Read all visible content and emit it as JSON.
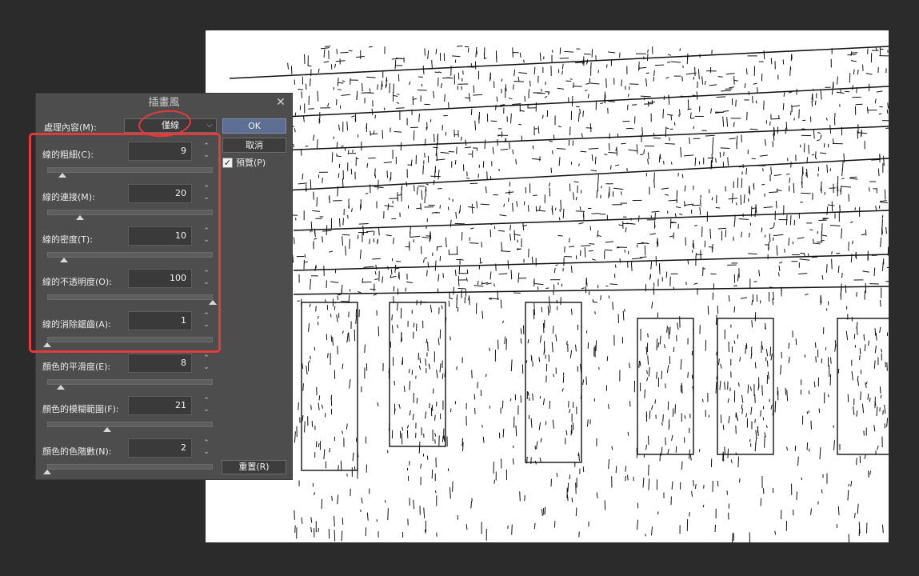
{
  "dialog": {
    "title": "插畫風",
    "close_icon": "close-icon",
    "process_label": "處理內容(M):",
    "process_value": "僅線",
    "ok_label": "OK",
    "cancel_label": "取消",
    "preview_label": "預覽(P)",
    "preview_checked": true,
    "reset_label": "重置(R)"
  },
  "params": [
    {
      "label": "線的粗細(C):",
      "value": "9",
      "level": 0.09
    },
    {
      "label": "線的連接(M):",
      "value": "20",
      "level": 0.2
    },
    {
      "label": "線的密度(T):",
      "value": "10",
      "level": 0.1
    },
    {
      "label": "線的不透明度(O):",
      "value": "100",
      "level": 1.0
    },
    {
      "label": "線的消除鋸齒(A):",
      "value": "1",
      "level": 0.0
    },
    {
      "label": "顏色的平滑度(E):",
      "value": "8",
      "level": 0.08
    },
    {
      "label": "顏色的模糊範圍(F):",
      "value": "21",
      "level": 0.36
    },
    {
      "label": "顏色的色階數(N):",
      "value": "2",
      "level": 0.0
    }
  ],
  "colors": {
    "background": "#2b2b2b",
    "dialog": "#4d4d4d",
    "ok_button": "#5d6e92",
    "highlight": "#e23b3b"
  }
}
